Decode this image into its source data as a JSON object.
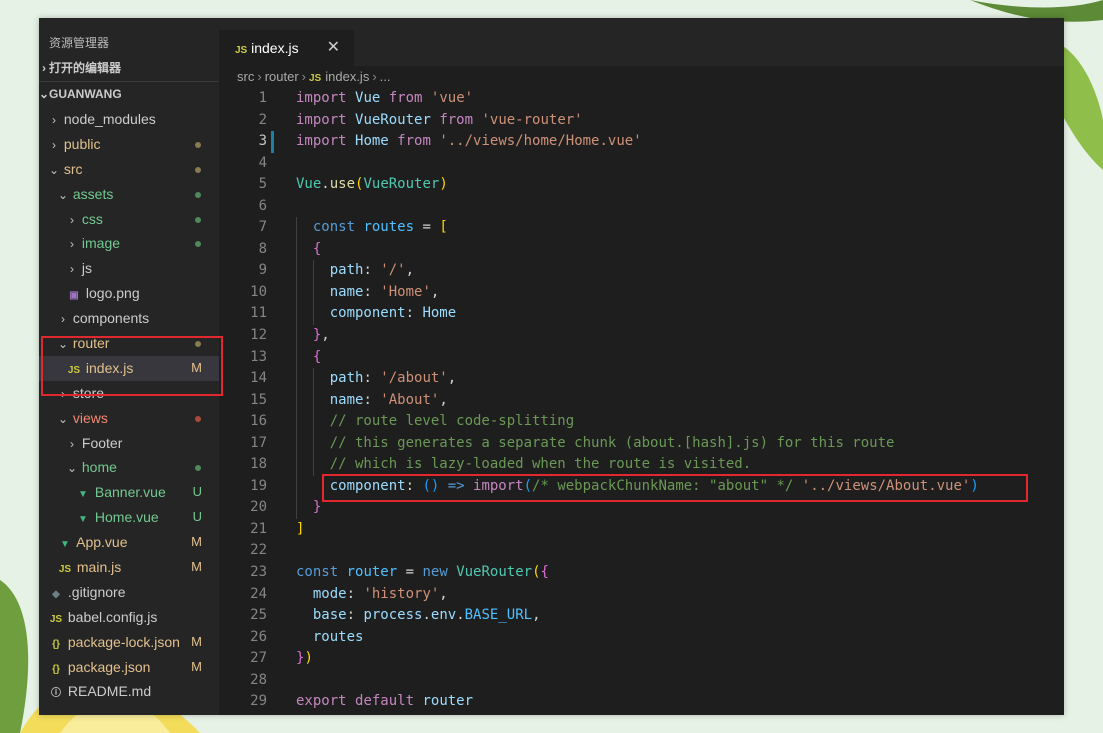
{
  "sidebar": {
    "title": "资源管理器",
    "open_editors": "打开的编辑器",
    "project": "GUANWANG",
    "items": [
      {
        "label": "node_modules",
        "type": "folder",
        "indent": 1,
        "status": "",
        "badge": ""
      },
      {
        "label": "public",
        "type": "folder",
        "indent": 1,
        "status": "modified",
        "badge": "dot"
      },
      {
        "label": "src",
        "type": "folder-open",
        "indent": 1,
        "status": "modified",
        "badge": "dot"
      },
      {
        "label": "assets",
        "type": "folder-open",
        "indent": 2,
        "status": "new",
        "badge": "dot"
      },
      {
        "label": "css",
        "type": "folder",
        "indent": 3,
        "status": "new",
        "badge": "dot"
      },
      {
        "label": "image",
        "type": "folder",
        "indent": 3,
        "status": "new",
        "badge": "dot"
      },
      {
        "label": "js",
        "type": "folder",
        "indent": 3,
        "status": "",
        "badge": ""
      },
      {
        "label": "logo.png",
        "type": "png",
        "indent": 3,
        "status": "",
        "badge": ""
      },
      {
        "label": "components",
        "type": "folder",
        "indent": 2,
        "status": "",
        "badge": ""
      },
      {
        "label": "router",
        "type": "folder-open",
        "indent": 2,
        "status": "modified",
        "badge": "dot"
      },
      {
        "label": "index.js",
        "type": "js",
        "indent": 3,
        "status": "modified",
        "badge": "M",
        "selected": true
      },
      {
        "label": "store",
        "type": "folder",
        "indent": 2,
        "status": "",
        "badge": ""
      },
      {
        "label": "views",
        "type": "folder-open",
        "indent": 2,
        "status": "error",
        "badge": "dot"
      },
      {
        "label": "Footer",
        "type": "folder",
        "indent": 3,
        "status": "",
        "badge": ""
      },
      {
        "label": "home",
        "type": "folder-open",
        "indent": 3,
        "status": "new",
        "badge": "dot"
      },
      {
        "label": "Banner.vue",
        "type": "vue",
        "indent": 4,
        "status": "new",
        "badge": "U"
      },
      {
        "label": "Home.vue",
        "type": "vue",
        "indent": 4,
        "status": "new",
        "badge": "U"
      },
      {
        "label": "App.vue",
        "type": "vue",
        "indent": 2,
        "status": "modified",
        "badge": "M"
      },
      {
        "label": "main.js",
        "type": "js",
        "indent": 2,
        "status": "modified",
        "badge": "M"
      },
      {
        "label": ".gitignore",
        "type": "git",
        "indent": 1,
        "status": "",
        "badge": ""
      },
      {
        "label": "babel.config.js",
        "type": "js",
        "indent": 1,
        "status": "",
        "badge": ""
      },
      {
        "label": "package-lock.json",
        "type": "json",
        "indent": 1,
        "status": "modified",
        "badge": "M"
      },
      {
        "label": "package.json",
        "type": "json",
        "indent": 1,
        "status": "modified",
        "badge": "M"
      },
      {
        "label": "README.md",
        "type": "info",
        "indent": 1,
        "status": "",
        "badge": ""
      }
    ]
  },
  "tab": {
    "label": "index.js",
    "icon": "JS",
    "close": "✕"
  },
  "breadcrumb": [
    "src",
    "router",
    "index.js",
    "..."
  ],
  "icons": {
    "js": "JS",
    "vue": "▼",
    "json": "{}",
    "png": "▣",
    "git": "◆",
    "info": "ⓘ",
    "chevron_right": "›",
    "chevron_down": "⌄"
  },
  "colors": {
    "accent": "#1b81a8",
    "highlight_box": "#e0282e"
  },
  "editor": {
    "active_line": 3,
    "lines": [
      [
        [
          "import",
          "kc"
        ],
        [
          " ",
          "p"
        ],
        [
          "Vue",
          "v"
        ],
        [
          " ",
          "p"
        ],
        [
          "from",
          "kc"
        ],
        [
          " ",
          "p"
        ],
        [
          "'vue'",
          "s"
        ]
      ],
      [
        [
          "import",
          "kc"
        ],
        [
          " ",
          "p"
        ],
        [
          "VueRouter",
          "v"
        ],
        [
          " ",
          "p"
        ],
        [
          "from",
          "kc"
        ],
        [
          " ",
          "p"
        ],
        [
          "'vue-router'",
          "s"
        ]
      ],
      [
        [
          "import",
          "kc"
        ],
        [
          " ",
          "p"
        ],
        [
          "Home",
          "v"
        ],
        [
          " ",
          "p"
        ],
        [
          "from",
          "kc"
        ],
        [
          " ",
          "p"
        ],
        [
          "'../views/home/Home.vue'",
          "s"
        ]
      ],
      [],
      [
        [
          "Vue",
          "t"
        ],
        [
          ".",
          "p"
        ],
        [
          "use",
          "f"
        ],
        [
          "(",
          "b1"
        ],
        [
          "VueRouter",
          "t"
        ],
        [
          ")",
          "b1"
        ]
      ],
      [],
      [
        [
          "  ",
          "p"
        ],
        [
          "const",
          "k"
        ],
        [
          " ",
          "p"
        ],
        [
          "routes",
          "cn"
        ],
        [
          " = ",
          "p"
        ],
        [
          "[",
          "b1"
        ]
      ],
      [
        [
          "  ",
          "p"
        ],
        [
          "{",
          "b2"
        ]
      ],
      [
        [
          "    ",
          "p"
        ],
        [
          "path",
          "v"
        ],
        [
          ": ",
          "p"
        ],
        [
          "'/'",
          "s"
        ],
        [
          ",",
          "p"
        ]
      ],
      [
        [
          "    ",
          "p"
        ],
        [
          "name",
          "v"
        ],
        [
          ": ",
          "p"
        ],
        [
          "'Home'",
          "s"
        ],
        [
          ",",
          "p"
        ]
      ],
      [
        [
          "    ",
          "p"
        ],
        [
          "component",
          "v"
        ],
        [
          ": ",
          "p"
        ],
        [
          "Home",
          "v"
        ]
      ],
      [
        [
          "  ",
          "p"
        ],
        [
          "}",
          "b2"
        ],
        [
          ",",
          "p"
        ]
      ],
      [
        [
          "  ",
          "p"
        ],
        [
          "{",
          "b2"
        ]
      ],
      [
        [
          "    ",
          "p"
        ],
        [
          "path",
          "v"
        ],
        [
          ": ",
          "p"
        ],
        [
          "'/about'",
          "s"
        ],
        [
          ",",
          "p"
        ]
      ],
      [
        [
          "    ",
          "p"
        ],
        [
          "name",
          "v"
        ],
        [
          ": ",
          "p"
        ],
        [
          "'About'",
          "s"
        ],
        [
          ",",
          "p"
        ]
      ],
      [
        [
          "    ",
          "p"
        ],
        [
          "// route level code-splitting",
          "c"
        ]
      ],
      [
        [
          "    ",
          "p"
        ],
        [
          "// this generates a separate chunk (about.[hash].js) for this route",
          "c"
        ]
      ],
      [
        [
          "    ",
          "p"
        ],
        [
          "// which is lazy-loaded when the route is visited.",
          "c"
        ]
      ],
      [
        [
          "    ",
          "p"
        ],
        [
          "component",
          "v"
        ],
        [
          ": ",
          "p"
        ],
        [
          "()",
          "b3"
        ],
        [
          " => ",
          "k"
        ],
        [
          "import",
          "kc"
        ],
        [
          "(",
          "b3"
        ],
        [
          "/* webpackChunkName: \"about\" */",
          "c"
        ],
        [
          " ",
          "p"
        ],
        [
          "'../views/About.vue'",
          "s"
        ],
        [
          ")",
          "b3"
        ]
      ],
      [
        [
          "  ",
          "p"
        ],
        [
          "}",
          "b2"
        ]
      ],
      [
        [
          "]",
          "b1"
        ]
      ],
      [],
      [
        [
          "const",
          "k"
        ],
        [
          " ",
          "p"
        ],
        [
          "router",
          "cn"
        ],
        [
          " = ",
          "p"
        ],
        [
          "new",
          "k"
        ],
        [
          " ",
          "p"
        ],
        [
          "VueRouter",
          "t"
        ],
        [
          "(",
          "b1"
        ],
        [
          "{",
          "b2"
        ]
      ],
      [
        [
          "  ",
          "p"
        ],
        [
          "mode",
          "v"
        ],
        [
          ": ",
          "p"
        ],
        [
          "'history'",
          "s"
        ],
        [
          ",",
          "p"
        ]
      ],
      [
        [
          "  ",
          "p"
        ],
        [
          "base",
          "v"
        ],
        [
          ": ",
          "p"
        ],
        [
          "process",
          "v"
        ],
        [
          ".",
          "p"
        ],
        [
          "env",
          "v"
        ],
        [
          ".",
          "p"
        ],
        [
          "BASE_URL",
          "cn"
        ],
        [
          ",",
          "p"
        ]
      ],
      [
        [
          "  ",
          "p"
        ],
        [
          "routes",
          "v"
        ]
      ],
      [
        [
          "}",
          "b2"
        ],
        [
          ")",
          "b1"
        ]
      ],
      [],
      [
        [
          "export",
          "kc"
        ],
        [
          " ",
          "p"
        ],
        [
          "default",
          "kc"
        ],
        [
          " ",
          "p"
        ],
        [
          "router",
          "v"
        ]
      ]
    ]
  }
}
